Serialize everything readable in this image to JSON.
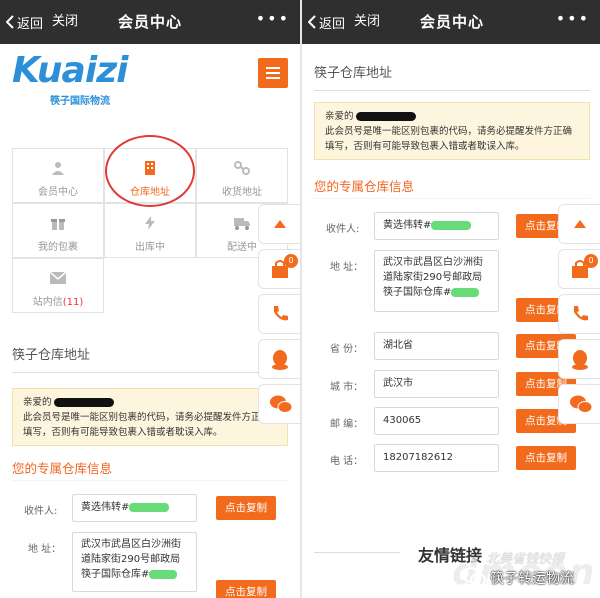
{
  "nav": {
    "back": "返回",
    "close": "关闭",
    "title": "会员中心",
    "more": "•••"
  },
  "logo": {
    "main": "Kuaizi",
    "sub": "筷子国际物流"
  },
  "grid": [
    {
      "label": "会员中心",
      "icon": "user-icon"
    },
    {
      "label": "仓库地址",
      "icon": "building-icon"
    },
    {
      "label": "收货地址",
      "icon": "link-icon"
    },
    {
      "label": "我的包裹",
      "icon": "gift-icon"
    },
    {
      "label": "出库中",
      "icon": "bolt-icon"
    },
    {
      "label": "配送中",
      "icon": "truck-icon"
    },
    {
      "label": "站内信",
      "badge": "(11)",
      "icon": "mail-icon"
    }
  ],
  "section_title": "筷子仓库地址",
  "notice": {
    "greeting": "亲爱的",
    "body": "此会员号是唯一能区别包裹的代码，请务必提醒发件方正确填写，否则有可能导致包裹入错或者耽误入库。"
  },
  "info_title": "您的专属仓库信息",
  "form": {
    "recipient": {
      "label": "收件人:",
      "value": "黄选伟转#"
    },
    "address": {
      "label": "地 址：",
      "value": "武汉市武昌区白沙洲街道陆家街290号邮政局筷子国际仓库#"
    },
    "province": {
      "label": "省 份：",
      "value": "湖北省"
    },
    "city": {
      "label": "城 市：",
      "value": "武汉市"
    },
    "zip": {
      "label": "邮 编：",
      "value": "430065"
    },
    "phone": {
      "label": "电 话：",
      "value": "18207182612"
    }
  },
  "copy_label": "点击复制",
  "cart_badge": "0",
  "friend_links": "友情链接",
  "watermark": {
    "top": "北美省钱快报",
    "bottom": "筷子转运物流",
    "big": "dmoon"
  },
  "colors": {
    "accent": "#f26b1d",
    "nav_bg": "#2f2f2f",
    "circle": "#e03a3a",
    "notice_bg": "#fdf5dd"
  }
}
